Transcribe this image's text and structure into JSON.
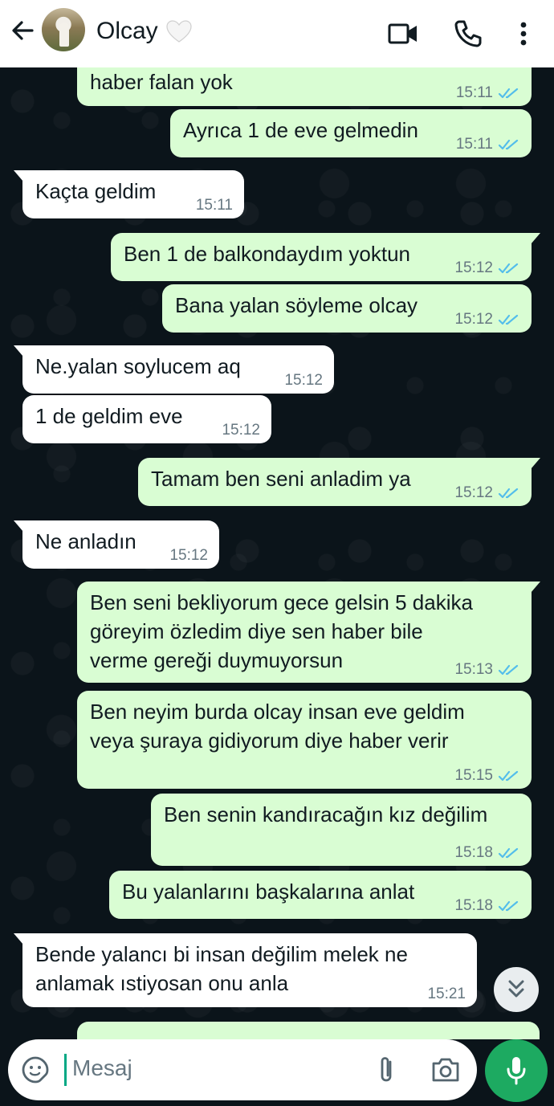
{
  "header": {
    "contact_name": "Olcay",
    "back_icon": "arrow-left-icon",
    "heart_icon": "white-heart-emoji-icon",
    "video_icon": "video-call-icon",
    "call_icon": "phone-icon",
    "menu_icon": "more-vertical-icon"
  },
  "messages": [
    {
      "dir": "out",
      "text": "haber falan yok",
      "time": "15:11"
    },
    {
      "dir": "out",
      "text": "Ayrıca 1 de eve gelmedin",
      "time": "15:11"
    },
    {
      "dir": "in",
      "text": "Kaçta geldim",
      "time": "15:11"
    },
    {
      "dir": "out",
      "text": "Ben 1 de balkondaydım yoktun",
      "time": "15:12"
    },
    {
      "dir": "out",
      "text": "Bana yalan söyleme olcay",
      "time": "15:12"
    },
    {
      "dir": "in",
      "text": "Ne.yalan soylucem aq",
      "time": "15:12"
    },
    {
      "dir": "in",
      "text": "1 de geldim eve",
      "time": "15:12"
    },
    {
      "dir": "out",
      "text": "Tamam ben seni anladim ya",
      "time": "15:12"
    },
    {
      "dir": "in",
      "text": "Ne anladın",
      "time": "15:12"
    },
    {
      "dir": "out",
      "text": "Ben seni bekliyorum gece gelsin 5 dakika\ngöreyim özledim diye sen haber bile\nverme gereği duymuyorsun",
      "time": "15:13"
    },
    {
      "dir": "out",
      "text": "Ben neyim burda olcay insan eve geldim\nveya şuraya gidiyorum diye haber verir",
      "time": "15:15"
    },
    {
      "dir": "out",
      "text": "Ben senin kandıracağın kız değilim",
      "time": "15:18"
    },
    {
      "dir": "out",
      "text": "Bu yalanlarını başkalarına anlat",
      "time": "15:18"
    },
    {
      "dir": "in",
      "text": "Bende yalancı bi insan değilim melek ne\nanlamak ıstiyosan onu anla",
      "time": "15:21"
    }
  ],
  "composer": {
    "placeholder": "Mesaj",
    "emoji_icon": "sticker-smiley-icon",
    "attach_icon": "paperclip-icon",
    "camera_icon": "camera-icon",
    "mic_icon": "microphone-icon"
  },
  "scroll_icon": "double-chevron-down-icon",
  "colors": {
    "chat_bg": "#0b141a",
    "outgoing_bubble": "#d9fdd3",
    "incoming_bubble": "#ffffff",
    "read_ticks": "#53bdeb",
    "accent": "#1daa61"
  }
}
